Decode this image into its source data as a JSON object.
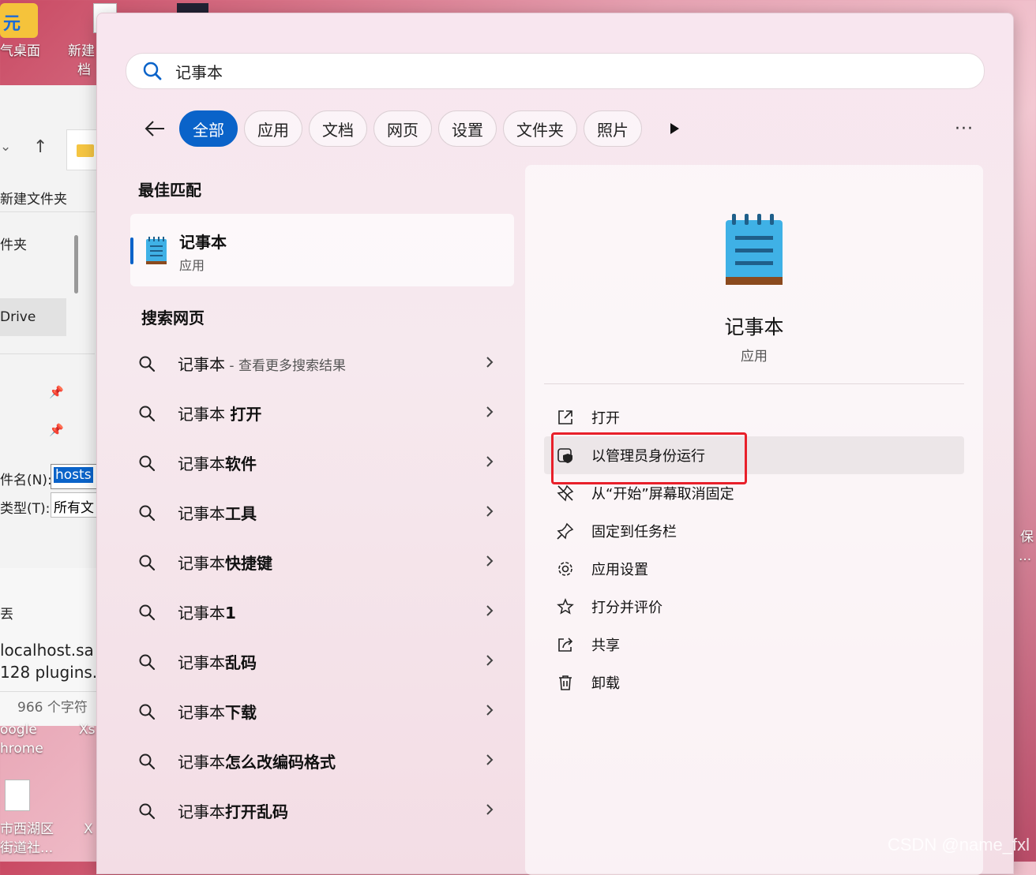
{
  "desktop": {
    "icon1_label": "气桌面",
    "icon2_label_line1": "新建",
    "icon2_label_line2": "档",
    "bottom_label1": "oogle",
    "bottom_label2": "hrome",
    "bottom_label3": "Xs",
    "bottom_label4": "市西湖区",
    "bottom_label5": "街道社...",
    "bottom_label6": "X",
    "right_label1": "保",
    "right_label2": "...",
    "watermark": "CSDN @name_fxl"
  },
  "explorer": {
    "new_folder": "新建文件夹",
    "folder_label": "件夹",
    "drive_label": "Drive",
    "filename_label": "件名(N):",
    "filename_value": "hosts",
    "filetype_label": "类型(T):",
    "filetype_value": "所有文",
    "misc_label": "丟",
    "text_line1": "localhost.sa",
    "text_line2": "128 plugins.",
    "char_count": "966 个字符"
  },
  "search": {
    "query": "记事本",
    "filters": [
      "全部",
      "应用",
      "文档",
      "网页",
      "设置",
      "文件夹",
      "照片"
    ],
    "more": "···"
  },
  "best_match": {
    "section": "最佳匹配",
    "name": "记事本",
    "type": "应用"
  },
  "web": {
    "section": "搜索网页",
    "items": [
      {
        "prefix": "记事本",
        "bold": "",
        "sub": " - 查看更多搜索结果"
      },
      {
        "prefix": "记事本 ",
        "bold": "打开",
        "sub": ""
      },
      {
        "prefix": "记事本",
        "bold": "软件",
        "sub": ""
      },
      {
        "prefix": "记事本",
        "bold": "工具",
        "sub": ""
      },
      {
        "prefix": "记事本",
        "bold": "快捷键",
        "sub": ""
      },
      {
        "prefix": "记事本",
        "bold": "1",
        "sub": ""
      },
      {
        "prefix": "记事本",
        "bold": "乱码",
        "sub": ""
      },
      {
        "prefix": "记事本",
        "bold": "下载",
        "sub": ""
      },
      {
        "prefix": "记事本",
        "bold": "怎么改编码格式",
        "sub": ""
      },
      {
        "prefix": "记事本",
        "bold": "打开乱码",
        "sub": ""
      }
    ]
  },
  "detail": {
    "name": "记事本",
    "type": "应用",
    "actions": [
      {
        "label": "打开",
        "icon": "open-external-icon"
      },
      {
        "label": "以管理员身份运行",
        "icon": "admin-shield-icon"
      },
      {
        "label": "从“开始”屏幕取消固定",
        "icon": "unpin-icon"
      },
      {
        "label": "固定到任务栏",
        "icon": "pin-icon"
      },
      {
        "label": "应用设置",
        "icon": "gear-icon"
      },
      {
        "label": "打分并评价",
        "icon": "star-rate-icon"
      },
      {
        "label": "共享",
        "icon": "share-icon"
      },
      {
        "label": "卸载",
        "icon": "trash-icon"
      }
    ]
  },
  "colors": {
    "accent": "#0a63c9",
    "highlight_box": "#e8202a"
  }
}
